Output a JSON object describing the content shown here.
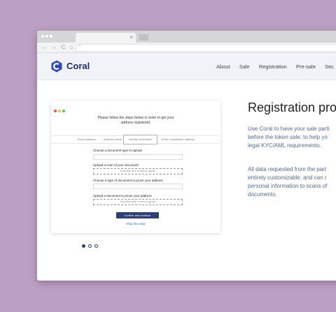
{
  "browser": {
    "tab_title": "",
    "tab_close": "×",
    "nav_icons": "← → C ⌂",
    "url": ""
  },
  "site": {
    "logo_text": "Coral",
    "nav": [
      "About",
      "Sale",
      "Registration",
      "Pre-sale",
      "Sec"
    ]
  },
  "card": {
    "heading_line1": "Please follow the steps below in order to get your",
    "heading_line2": "address registered.",
    "steps": [
      "Prove address",
      "Address check",
      "Identity verification",
      "Enter contribution address"
    ],
    "field1_label": "Choose a document type to upload",
    "field2_label": "Upload a scan of your document",
    "field2_drop": "Drop files here or click to upload",
    "field3_label": "Choose a type of document to prove your address",
    "field4_label": "Upload a document to prove your address",
    "field4_drop": "Drop files here or click to upload",
    "confirm": "Confirm and continue",
    "skip": "Skip this step"
  },
  "section": {
    "title": "Registration pro",
    "para1": [
      "Use Coral to have your sale parti",
      "before the token sale, to help yo",
      "legal KYC/AML requirements."
    ],
    "para2": [
      "All data requested from the part",
      "entirely customizable, and can r",
      "personal information to scans of",
      "documents."
    ]
  },
  "colors": {
    "accent": "#2d3f73",
    "link": "#3b67c9",
    "background": "#bca0c3"
  }
}
